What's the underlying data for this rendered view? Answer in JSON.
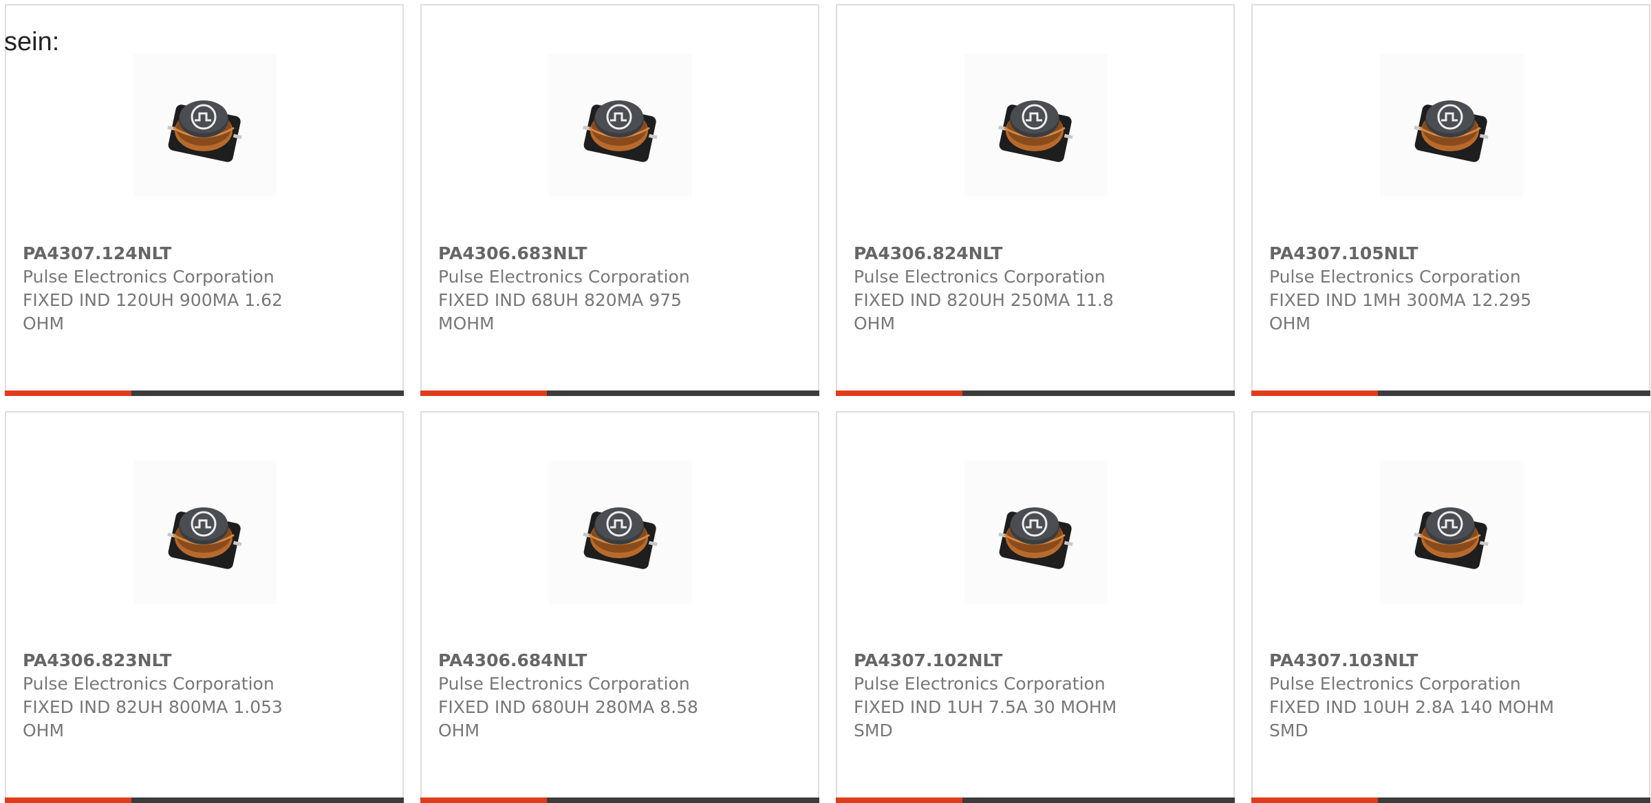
{
  "intro_text": "sein:",
  "colors": {
    "accent": "#e03c1c",
    "bar": "#3c3c3c",
    "border": "#dddddd",
    "text": "#777777"
  },
  "products": [
    {
      "part": "PA4307.124NLT",
      "manufacturer": "Pulse Electronics Corporation",
      "desc_line1": "FIXED IND 120UH 900MA 1.62",
      "desc_line2": "OHM",
      "image_icon": "smd-power-inductor-icon"
    },
    {
      "part": "PA4306.683NLT",
      "manufacturer": "Pulse Electronics Corporation",
      "desc_line1": "FIXED IND 68UH 820MA 975",
      "desc_line2": "MOHM",
      "image_icon": "smd-power-inductor-icon"
    },
    {
      "part": "PA4306.824NLT",
      "manufacturer": "Pulse Electronics Corporation",
      "desc_line1": "FIXED IND 820UH 250MA 11.8",
      "desc_line2": "OHM",
      "image_icon": "smd-power-inductor-icon"
    },
    {
      "part": "PA4307.105NLT",
      "manufacturer": "Pulse Electronics Corporation",
      "desc_line1": "FIXED IND 1MH 300MA 12.295",
      "desc_line2": "OHM",
      "image_icon": "smd-power-inductor-icon"
    },
    {
      "part": "PA4306.823NLT",
      "manufacturer": "Pulse Electronics Corporation",
      "desc_line1": "FIXED IND 82UH 800MA 1.053",
      "desc_line2": "OHM",
      "image_icon": "smd-power-inductor-icon"
    },
    {
      "part": "PA4306.684NLT",
      "manufacturer": "Pulse Electronics Corporation",
      "desc_line1": "FIXED IND 680UH 280MA 8.58",
      "desc_line2": "OHM",
      "image_icon": "smd-power-inductor-icon"
    },
    {
      "part": "PA4307.102NLT",
      "manufacturer": "Pulse Electronics Corporation",
      "desc_line1": "FIXED IND 1UH 7.5A 30 MOHM",
      "desc_line2": "SMD",
      "image_icon": "smd-power-inductor-icon"
    },
    {
      "part": "PA4307.103NLT",
      "manufacturer": "Pulse Electronics Corporation",
      "desc_line1": "FIXED IND 10UH 2.8A 140 MOHM",
      "desc_line2": "SMD",
      "image_icon": "smd-power-inductor-icon"
    }
  ]
}
